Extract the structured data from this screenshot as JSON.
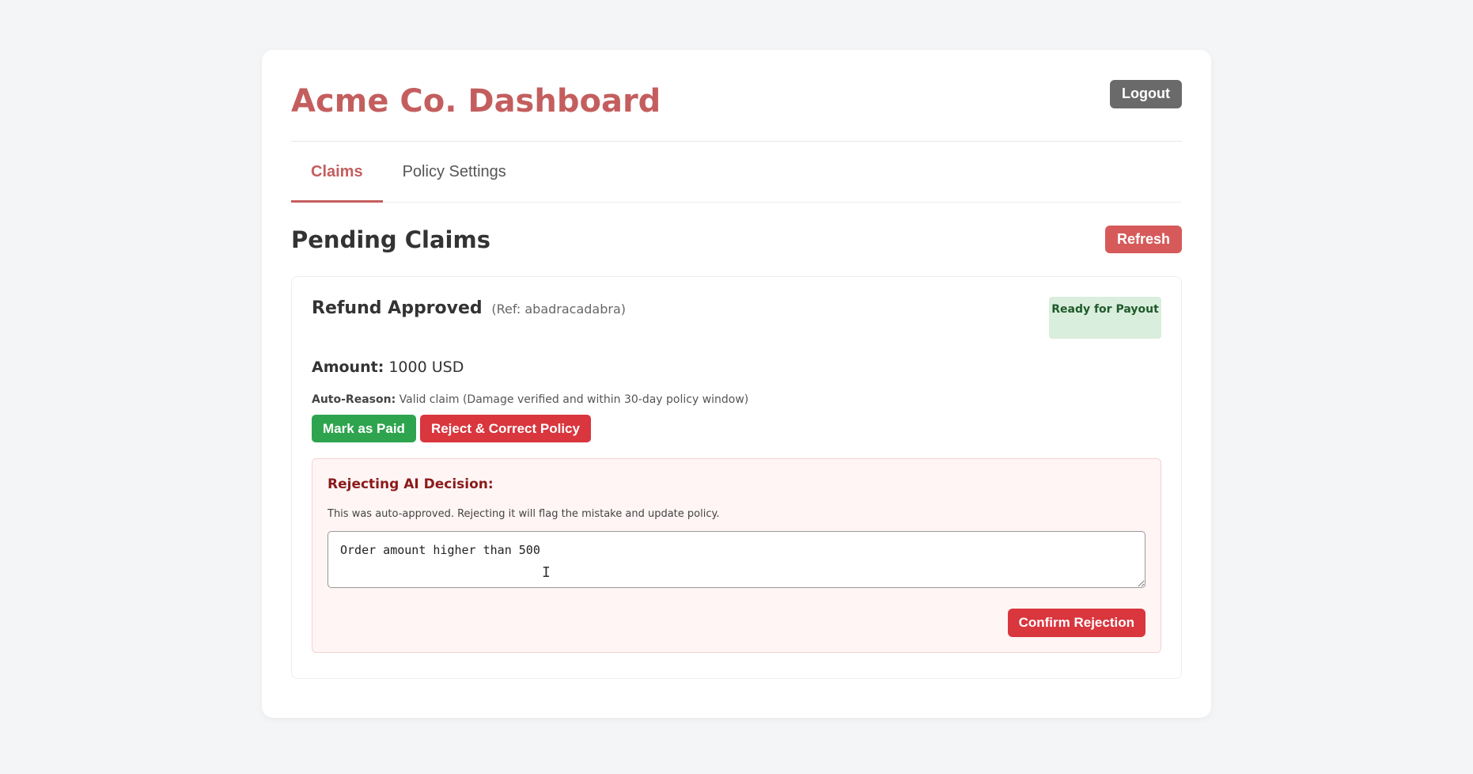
{
  "header": {
    "title": "Acme Co. Dashboard",
    "logout_label": "Logout"
  },
  "tabs": [
    {
      "label": "Claims",
      "active": true
    },
    {
      "label": "Policy Settings",
      "active": false
    }
  ],
  "section": {
    "title": "Pending Claims",
    "refresh_label": "Refresh"
  },
  "claim": {
    "title": "Refund Approved",
    "ref": "(Ref: abadracadabra)",
    "status_badge": "Ready for Payout",
    "amount_label": "Amount:",
    "amount_value": "1000 USD",
    "reason_label": "Auto-Reason:",
    "reason_value": "Valid claim (Damage verified and within 30-day policy window)",
    "mark_paid_label": "Mark as Paid",
    "reject_label": "Reject & Correct Policy"
  },
  "rejection": {
    "title": "Rejecting AI Decision:",
    "description": "This was auto-approved. Rejecting it will flag the mistake and update policy.",
    "input_value": "Order amount higher than 500",
    "cursor_glyph": "I",
    "confirm_label": "Confirm Rejection"
  },
  "colors": {
    "brand": "#c45e5e",
    "success": "#2ea44f",
    "danger": "#d9363e",
    "badge_bg": "#d9eedc"
  }
}
